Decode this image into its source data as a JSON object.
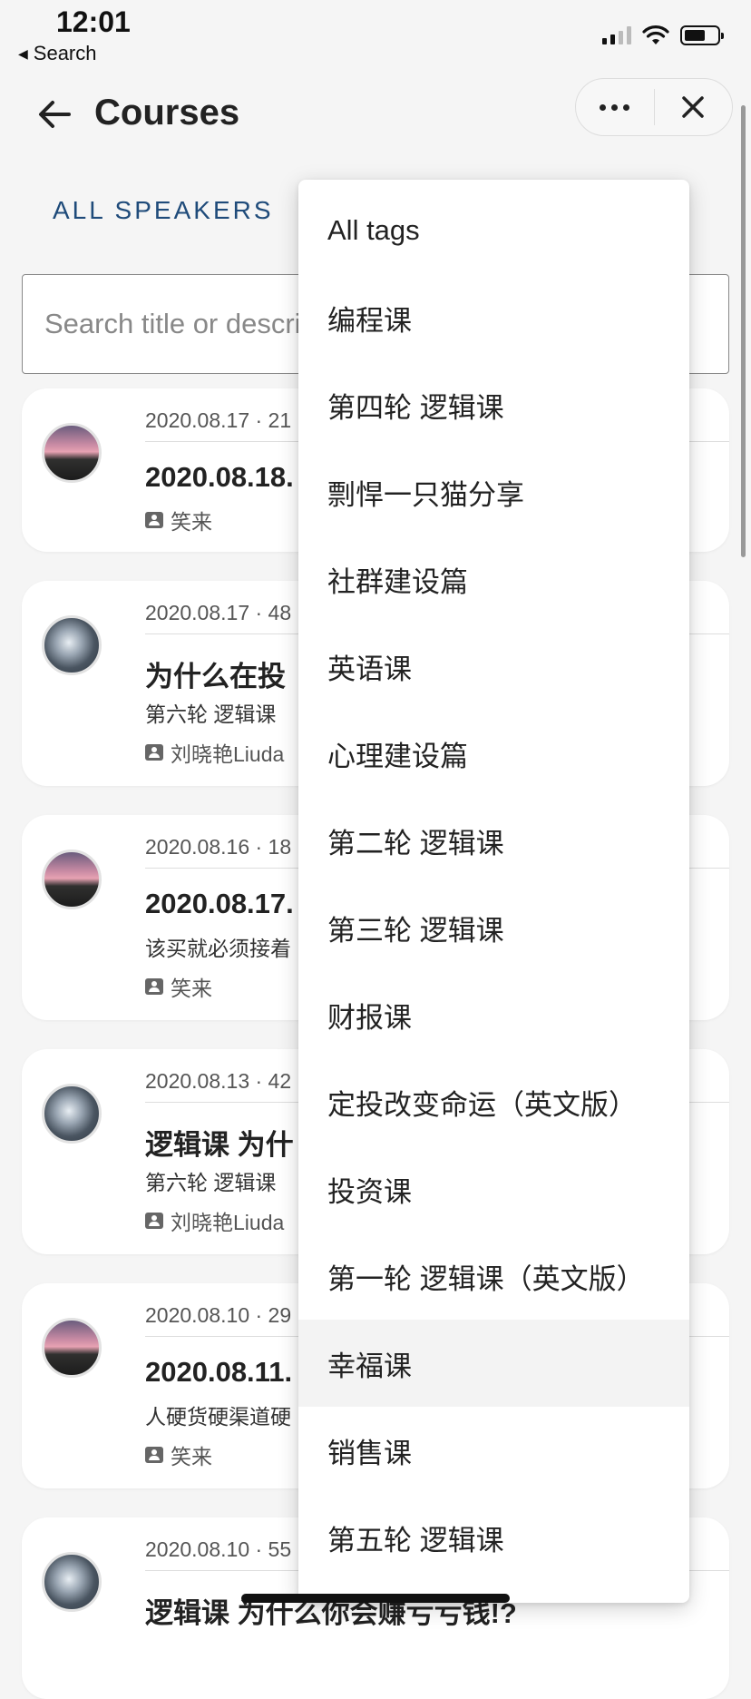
{
  "status_bar": {
    "time": "12:01",
    "back_app": "Search"
  },
  "nav": {
    "title": "Courses"
  },
  "filters": {
    "speakers_label": "ALL SPEAKERS"
  },
  "search": {
    "placeholder": "Search title or description"
  },
  "courses": [
    {
      "date": "2020.08.17 · 21",
      "title": "2020.08.18.",
      "subtitle": "",
      "speaker": "笑来",
      "avatar": "sunset"
    },
    {
      "date": "2020.08.17 · 48",
      "title": "为什么在投",
      "subtitle": "第六轮 逻辑课",
      "speaker": "刘晓艳Liuda",
      "avatar": "robot"
    },
    {
      "date": "2020.08.16 · 18",
      "title": "2020.08.17.",
      "subtitle": "该买就必须接着",
      "speaker": "笑来",
      "avatar": "sunset"
    },
    {
      "date": "2020.08.13 · 42",
      "title": "逻辑课 为什",
      "subtitle": "第六轮 逻辑课",
      "speaker": "刘晓艳Liuda",
      "avatar": "robot"
    },
    {
      "date": "2020.08.10 · 29",
      "title": "2020.08.11.",
      "subtitle": "人硬货硬渠道硬",
      "speaker": "笑来",
      "avatar": "sunset"
    },
    {
      "date": "2020.08.10 · 55",
      "title": "逻辑课 为什么你会赚亏亏钱!?",
      "subtitle": "",
      "speaker": "",
      "avatar": "robot"
    }
  ],
  "tag_menu": {
    "items": [
      "All tags",
      "编程课",
      "第四轮 逻辑课",
      "剽悍一只猫分享",
      "社群建设篇",
      "英语课",
      "心理建设篇",
      "第二轮 逻辑课",
      "第三轮 逻辑课",
      "财报课",
      "定投改变命运（英文版）",
      "投资课",
      "第一轮 逻辑课（英文版）",
      "幸福课",
      "销售课",
      "第五轮 逻辑课"
    ],
    "highlighted": "幸福课"
  }
}
